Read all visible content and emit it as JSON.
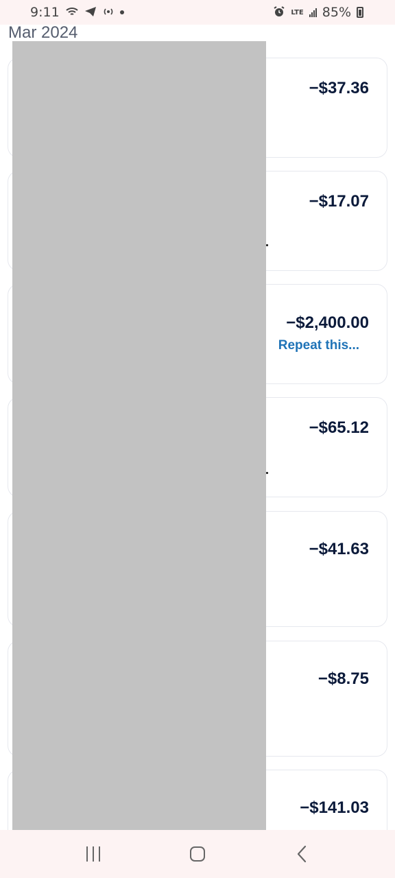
{
  "status_bar": {
    "time": "9:11",
    "network": "LTE",
    "battery": "85%"
  },
  "month_label": "Mar 2024",
  "transactions": [
    {
      "amount": "−$37.36"
    },
    {
      "amount": "−$17.07"
    },
    {
      "amount": "−$2,400.00",
      "action": "Repeat this..."
    },
    {
      "amount": "−$65.12"
    },
    {
      "amount": "−$41.63"
    },
    {
      "amount": "−$8.75"
    },
    {
      "amount": "−$141.03"
    }
  ],
  "icons": {
    "wifi": "wifi-icon",
    "telegram": "telegram-icon",
    "hotspot": "hotspot-icon",
    "alarm": "alarm-icon",
    "signal": "signal-icon",
    "battery": "battery-icon",
    "recents": "recents-icon",
    "home": "home-icon",
    "back": "back-icon"
  },
  "colors": {
    "amount_text": "#0b1a3a",
    "link": "#1f73b7",
    "redaction": "#c2c2c2",
    "system_bar": "#fdf3f3"
  }
}
